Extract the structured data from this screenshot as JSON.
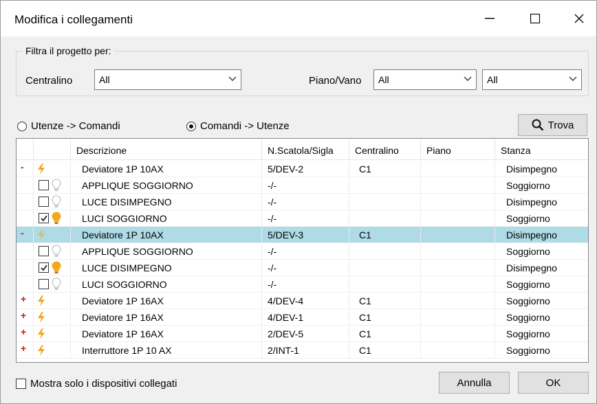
{
  "window": {
    "title": "Modifica i collegamenti"
  },
  "filter": {
    "legend": "Filtra il progetto per:",
    "centralino_label": "Centralino",
    "centralino_value": "All",
    "piano_label": "Piano/Vano",
    "piano_value": "All",
    "vano_value": "All"
  },
  "mode": {
    "option1": "Utenze -> Comandi",
    "option2": "Comandi -> Utenze",
    "selected": "option2"
  },
  "find_button": "Trova",
  "table": {
    "columns": [
      "Descrizione",
      "N.Scatola/Sigla",
      "Centralino",
      "Piano",
      "Stanza"
    ],
    "rows": [
      {
        "kind": "device",
        "exp": "-",
        "desc": "Deviatore 1P 10AX",
        "sigla": "5/DEV-2",
        "central": "C1",
        "piano": "",
        "stanza": "Disimpegno"
      },
      {
        "kind": "load",
        "checked": false,
        "desc": "APPLIQUE SOGGIORNO",
        "sigla": "-/-",
        "central": "",
        "piano": "",
        "stanza": "Soggiorno"
      },
      {
        "kind": "load",
        "checked": false,
        "desc": "LUCE DISIMPEGNO",
        "sigla": "-/-",
        "central": "",
        "piano": "",
        "stanza": "Disimpegno"
      },
      {
        "kind": "load",
        "checked": true,
        "desc": "LUCI SOGGIORNO",
        "sigla": "-/-",
        "central": "",
        "piano": "",
        "stanza": "Soggiorno"
      },
      {
        "kind": "device",
        "exp": "-",
        "selected": true,
        "desc": "Deviatore 1P 10AX",
        "sigla": "5/DEV-3",
        "central": "C1",
        "piano": "",
        "stanza": "Disimpegno"
      },
      {
        "kind": "load",
        "checked": false,
        "desc": "APPLIQUE SOGGIORNO",
        "sigla": "-/-",
        "central": "",
        "piano": "",
        "stanza": "Soggiorno"
      },
      {
        "kind": "load",
        "checked": true,
        "desc": "LUCE DISIMPEGNO",
        "sigla": "-/-",
        "central": "",
        "piano": "",
        "stanza": "Disimpegno"
      },
      {
        "kind": "load",
        "checked": false,
        "desc": "LUCI SOGGIORNO",
        "sigla": "-/-",
        "central": "",
        "piano": "",
        "stanza": "Soggiorno"
      },
      {
        "kind": "device",
        "exp": "+",
        "desc": "Deviatore 1P 16AX",
        "sigla": "4/DEV-4",
        "central": "C1",
        "piano": "",
        "stanza": "Soggiorno"
      },
      {
        "kind": "device",
        "exp": "+",
        "desc": "Deviatore 1P 16AX",
        "sigla": "4/DEV-1",
        "central": "C1",
        "piano": "",
        "stanza": "Soggiorno"
      },
      {
        "kind": "device",
        "exp": "+",
        "desc": "Deviatore 1P 16AX",
        "sigla": "2/DEV-5",
        "central": "C1",
        "piano": "",
        "stanza": "Soggiorno"
      },
      {
        "kind": "device",
        "exp": "+",
        "desc": "Interruttore 1P 10 AX",
        "sigla": "2/INT-1",
        "central": "C1",
        "piano": "",
        "stanza": "Soggiorno"
      }
    ]
  },
  "footer": {
    "show_connected_label": "Mostra solo i dispositivi collegati",
    "cancel_label": "Annulla",
    "ok_label": "OK"
  },
  "colors": {
    "selection": "#aedbe6",
    "bolt": "#f2a81d",
    "bulb_on": "#f2a81d",
    "expander": "#d21111"
  }
}
